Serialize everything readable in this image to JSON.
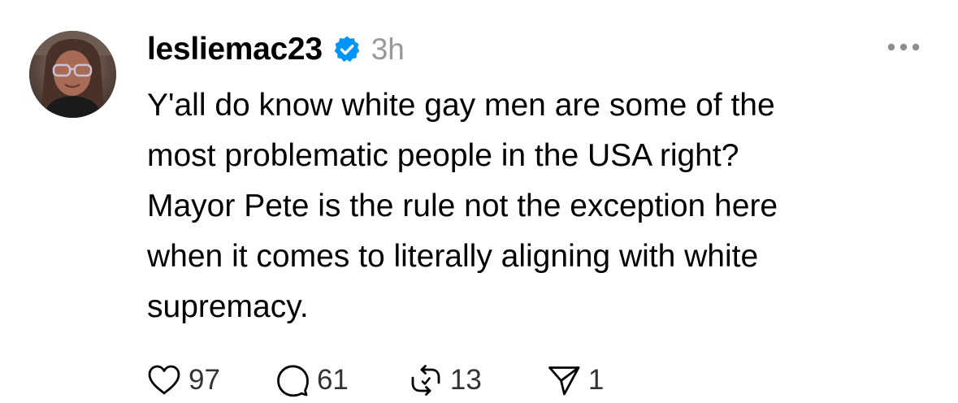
{
  "post": {
    "username": "lesliemac23",
    "verified": true,
    "timestamp": "3h",
    "text": "Y'all do know white gay men are some of the\nmost problematic people in the USA right?\nMayor Pete is the rule not the exception here\nwhen it comes to literally aligning with white\nsupremacy.",
    "actions": {
      "likes": "97",
      "replies": "61",
      "reposts": "13",
      "shares": "1"
    },
    "icons": {
      "like": "heart-icon",
      "reply": "comment-bubble-icon",
      "repost": "repost-icon",
      "share": "send-icon",
      "more": "ellipsis-icon",
      "verified": "verified-badge-icon"
    },
    "colors": {
      "verified_badge": "#0095f6",
      "timestamp": "#999999",
      "icon_stroke": "#000000"
    }
  }
}
